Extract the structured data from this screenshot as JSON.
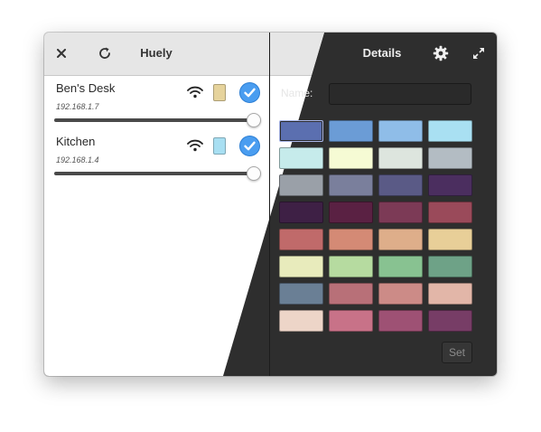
{
  "app_title": "Huely",
  "details_title": "Details",
  "icons": {
    "close": "close-icon",
    "refresh": "refresh-icon",
    "settings": "gear-icon",
    "fullscreen": "fullscreen-icon",
    "wifi": "wifi-icon",
    "check": "check-icon"
  },
  "devices": [
    {
      "name": "Ben's Desk",
      "ip": "192.168.1.7",
      "color": "#e6d39c",
      "connected": true,
      "brightness": 1.0
    },
    {
      "name": "Kitchen",
      "ip": "192.168.1.4",
      "color": "#a8dff2",
      "connected": true,
      "brightness": 1.0
    }
  ],
  "details": {
    "name_label": "Name:",
    "name_value": "",
    "set_label": "Set"
  },
  "palette": [
    "#5b6fb0",
    "#6b9cd6",
    "#8fbde8",
    "#a9e0f2",
    "#c6ebeb",
    "#f6fbd4",
    "#dde5de",
    "#b3bcc3",
    "#9aa0a8",
    "#7a7f9c",
    "#5a5a86",
    "#4b2e5f",
    "#3e2045",
    "#5a2143",
    "#7c3a56",
    "#9a4a5a",
    "#c06a6a",
    "#d48a75",
    "#deae8a",
    "#e8cf98",
    "#e8ebbc",
    "#b6dba0",
    "#88c291",
    "#6ea287",
    "#6a7f95",
    "#b87078",
    "#cc8b87",
    "#e2b6a8",
    "#edd5c8",
    "#c87288",
    "#9e5174",
    "#773d66"
  ],
  "selected_palette_index": 0,
  "accent_color": "#4a9df0"
}
